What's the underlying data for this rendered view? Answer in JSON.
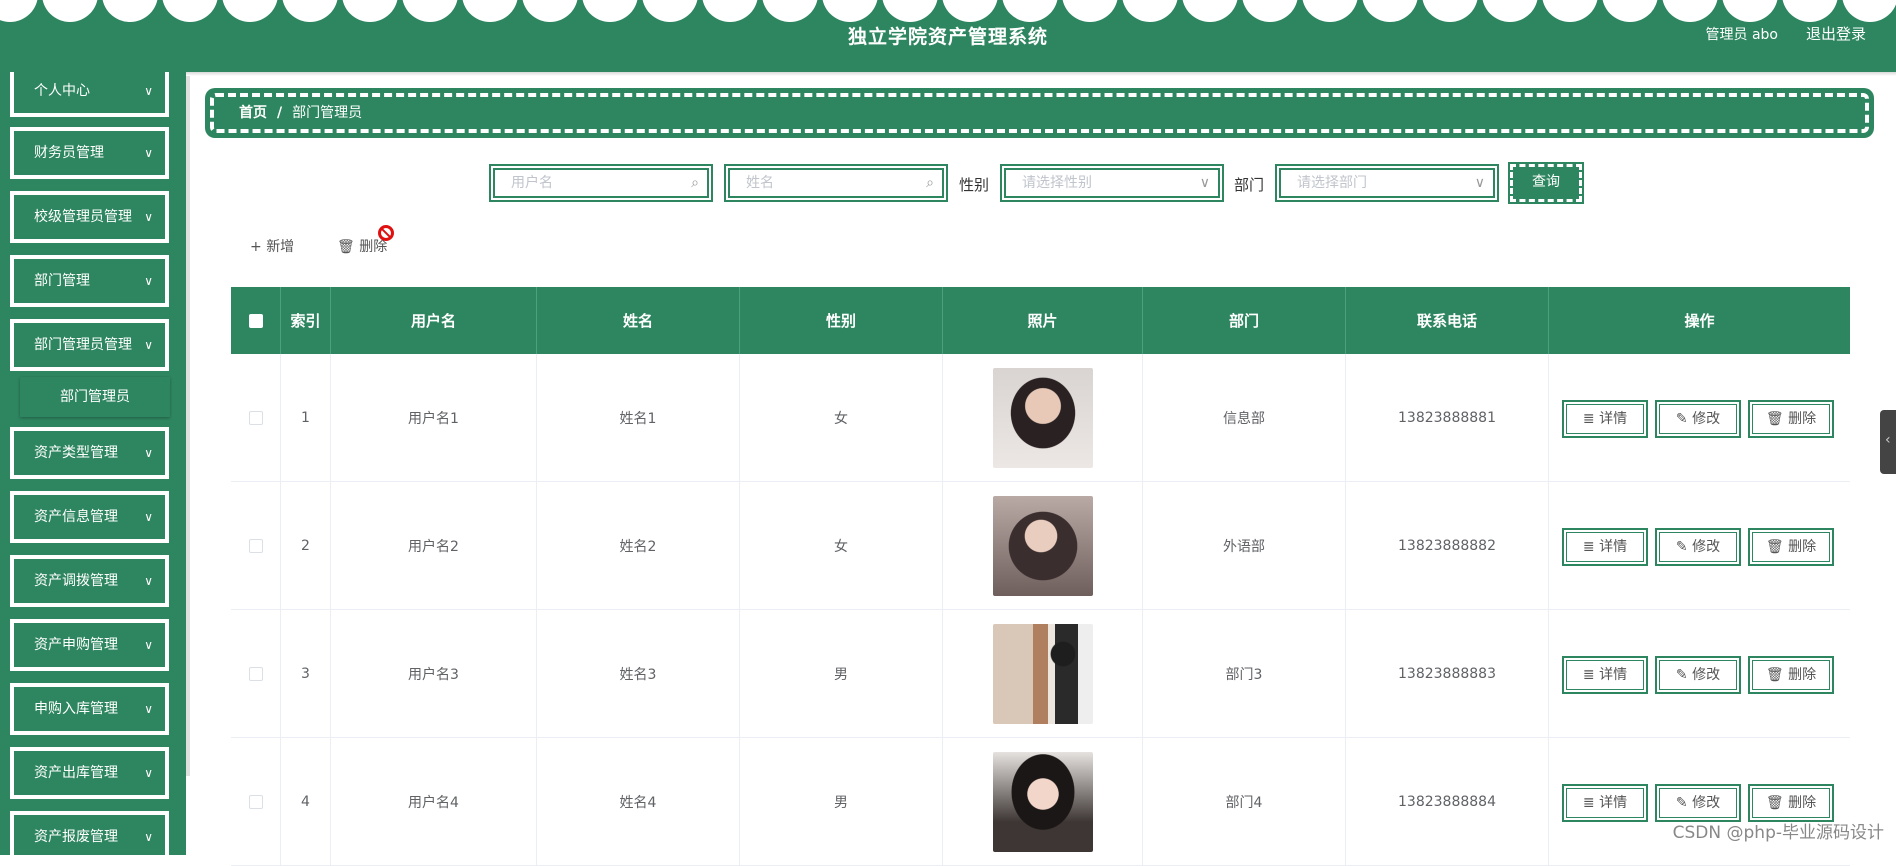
{
  "header": {
    "title": "独立学院资产管理系统",
    "user_label": "管理员 abo",
    "logout_label": "退出登录"
  },
  "sidebar": {
    "items": [
      {
        "label": "个人中心"
      },
      {
        "label": "财务员管理"
      },
      {
        "label": "校级管理员管理"
      },
      {
        "label": "部门管理"
      },
      {
        "label": "部门管理员管理"
      },
      {
        "label": "资产类型管理"
      },
      {
        "label": "资产信息管理"
      },
      {
        "label": "资产调拨管理"
      },
      {
        "label": "资产申购管理"
      },
      {
        "label": "申购入库管理"
      },
      {
        "label": "资产出库管理"
      },
      {
        "label": "资产报废管理"
      }
    ],
    "sub_item": "部门管理员",
    "chevron": "∨"
  },
  "breadcrumb": {
    "home": "首页",
    "separator": "/",
    "current": "部门管理员"
  },
  "search": {
    "username_placeholder": "用户名",
    "name_placeholder": "姓名",
    "gender_label": "性别",
    "gender_placeholder": "请选择性别",
    "dept_label": "部门",
    "dept_placeholder": "请选择部门",
    "query_label": "查询"
  },
  "actions": {
    "add_label": "新增",
    "delete_label": "删除"
  },
  "table": {
    "headers": {
      "index": "索引",
      "username": "用户名",
      "name": "姓名",
      "gender": "性别",
      "photo": "照片",
      "dept": "部门",
      "phone": "联系电话",
      "ops": "操作"
    },
    "rows": [
      {
        "index": "1",
        "username": "用户名1",
        "name": "姓名1",
        "gender": "女",
        "dept": "信息部",
        "phone": "13823888881"
      },
      {
        "index": "2",
        "username": "用户名2",
        "name": "姓名2",
        "gender": "女",
        "dept": "外语部",
        "phone": "13823888882"
      },
      {
        "index": "3",
        "username": "用户名3",
        "name": "姓名3",
        "gender": "男",
        "dept": "部门3",
        "phone": "13823888883"
      },
      {
        "index": "4",
        "username": "用户名4",
        "name": "姓名4",
        "gender": "男",
        "dept": "部门4",
        "phone": "13823888884"
      }
    ],
    "op_labels": {
      "detail": "详情",
      "edit": "修改",
      "delete": "删除"
    }
  },
  "watermark": "CSDN @php-毕业源码设计",
  "colors": {
    "primary": "#2e8660",
    "white": "#ffffff"
  }
}
